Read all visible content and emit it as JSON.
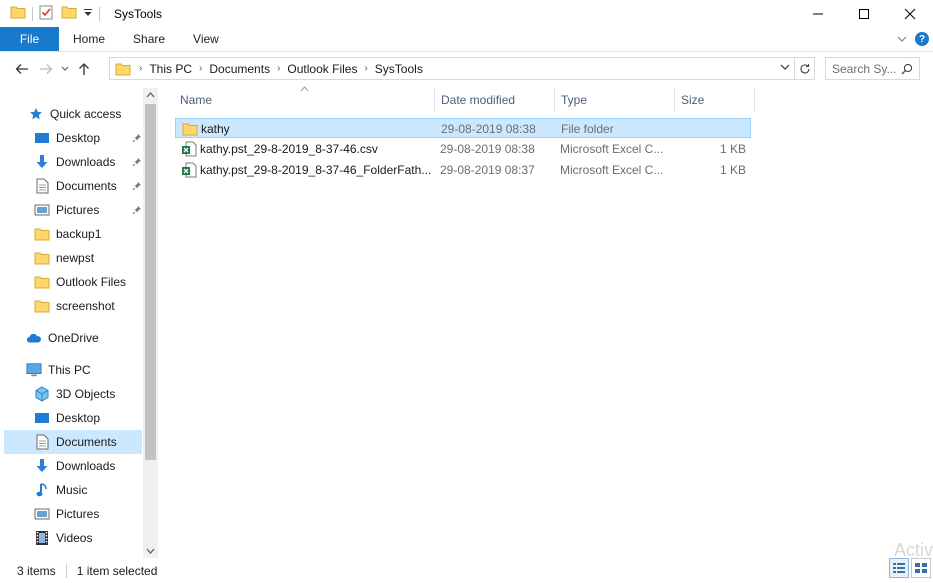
{
  "window": {
    "title": "SysTools"
  },
  "ribbon": {
    "file": "File",
    "tabs": [
      "Home",
      "Share",
      "View"
    ],
    "help": "?"
  },
  "address": {
    "crumbs": [
      "This PC",
      "Documents",
      "Outlook Files",
      "SysTools"
    ]
  },
  "search": {
    "placeholder": "Search Sy..."
  },
  "sidebar": {
    "quick_access": "Quick access",
    "quick_items": [
      "Desktop",
      "Downloads",
      "Documents",
      "Pictures",
      "backup1",
      "newpst",
      "Outlook Files",
      "screenshot"
    ],
    "onedrive": "OneDrive",
    "this_pc": "This PC",
    "pc_items": [
      "3D Objects",
      "Desktop",
      "Documents",
      "Downloads",
      "Music",
      "Pictures",
      "Videos"
    ]
  },
  "columns": {
    "name": "Name",
    "date": "Date modified",
    "type": "Type",
    "size": "Size"
  },
  "files": [
    {
      "name": "kathy",
      "date": "29-08-2019 08:38",
      "type": "File folder",
      "size": ""
    },
    {
      "name": "kathy.pst_29-8-2019_8-37-46.csv",
      "date": "29-08-2019 08:38",
      "type": "Microsoft Excel C...",
      "size": "1 KB"
    },
    {
      "name": "kathy.pst_29-8-2019_8-37-46_FolderFath...",
      "date": "29-08-2019 08:37",
      "type": "Microsoft Excel C...",
      "size": "1 KB"
    }
  ],
  "status": {
    "count": "3 items",
    "selected": "1 item selected"
  },
  "watermark": "Activ"
}
